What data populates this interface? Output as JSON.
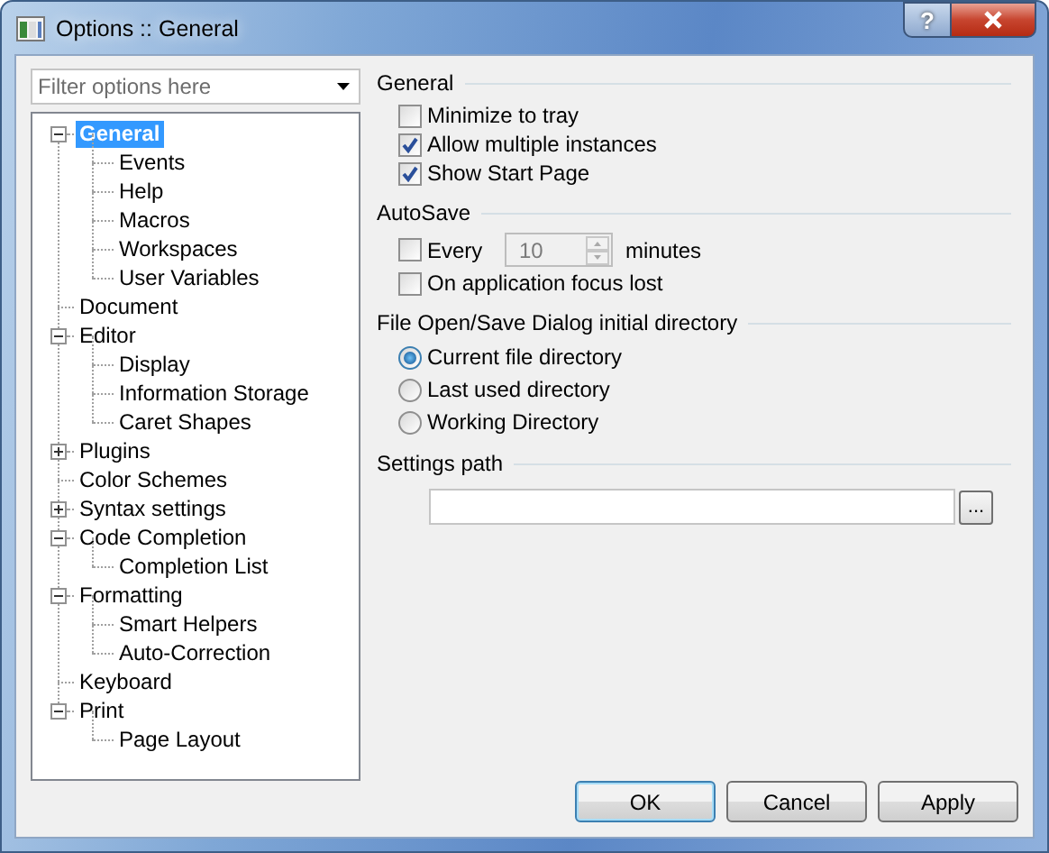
{
  "window": {
    "title": "Options :: General",
    "help_label": "?"
  },
  "filter": {
    "placeholder": "Filter options here"
  },
  "tree": [
    {
      "label": "General",
      "selected": true,
      "expanded": true,
      "children": [
        {
          "label": "Events",
          "selected": false
        },
        {
          "label": "Help",
          "selected": false
        },
        {
          "label": "Macros",
          "selected": false
        },
        {
          "label": "Workspaces",
          "selected": false
        },
        {
          "label": "User Variables",
          "selected": false
        }
      ]
    },
    {
      "label": "Document",
      "selected": false
    },
    {
      "label": "Editor",
      "selected": false,
      "expanded": true,
      "children": [
        {
          "label": "Display",
          "selected": false
        },
        {
          "label": "Information Storage",
          "selected": false
        },
        {
          "label": "Caret Shapes",
          "selected": false
        }
      ]
    },
    {
      "label": "Plugins",
      "selected": false,
      "expanded": false
    },
    {
      "label": "Color Schemes",
      "selected": false
    },
    {
      "label": "Syntax settings",
      "selected": false,
      "expanded": false
    },
    {
      "label": "Code Completion",
      "selected": false,
      "expanded": true,
      "children": [
        {
          "label": "Completion List",
          "selected": false
        }
      ]
    },
    {
      "label": "Formatting",
      "selected": false,
      "expanded": true,
      "children": [
        {
          "label": "Smart Helpers",
          "selected": false
        },
        {
          "label": "Auto-Correction",
          "selected": false
        }
      ]
    },
    {
      "label": "Keyboard",
      "selected": false
    },
    {
      "label": "Print",
      "selected": false,
      "expanded": true,
      "children": [
        {
          "label": "Page Layout",
          "selected": false
        }
      ]
    }
  ],
  "sections": [
    {
      "title": "General",
      "items": [
        {
          "kind": "checkbox",
          "label": "Minimize to tray",
          "checked": false
        },
        {
          "kind": "checkbox",
          "label": "Allow multiple instances",
          "checked": true
        },
        {
          "kind": "checkbox",
          "label": "Show Start Page",
          "checked": true
        }
      ]
    },
    {
      "title": "AutoSave",
      "items": [
        {
          "kind": "checkbox_spin",
          "label": "Every",
          "checked": false,
          "value": "10",
          "unit": "minutes",
          "disabled": true
        },
        {
          "kind": "checkbox",
          "label": "On application focus lost",
          "checked": false
        }
      ]
    },
    {
      "title": "File Open/Save Dialog initial directory",
      "items": [
        {
          "kind": "radio",
          "label": "Current file directory",
          "selected": true
        },
        {
          "kind": "radio",
          "label": "Last used directory",
          "selected": false
        },
        {
          "kind": "radio",
          "label": "Working Directory",
          "selected": false
        }
      ]
    },
    {
      "title": "Settings path",
      "items": [
        {
          "kind": "path",
          "browse_label": "..."
        }
      ]
    }
  ],
  "buttons": [
    {
      "label": "OK",
      "default": true
    },
    {
      "label": "Cancel",
      "default": false
    },
    {
      "label": "Apply",
      "default": false
    }
  ]
}
